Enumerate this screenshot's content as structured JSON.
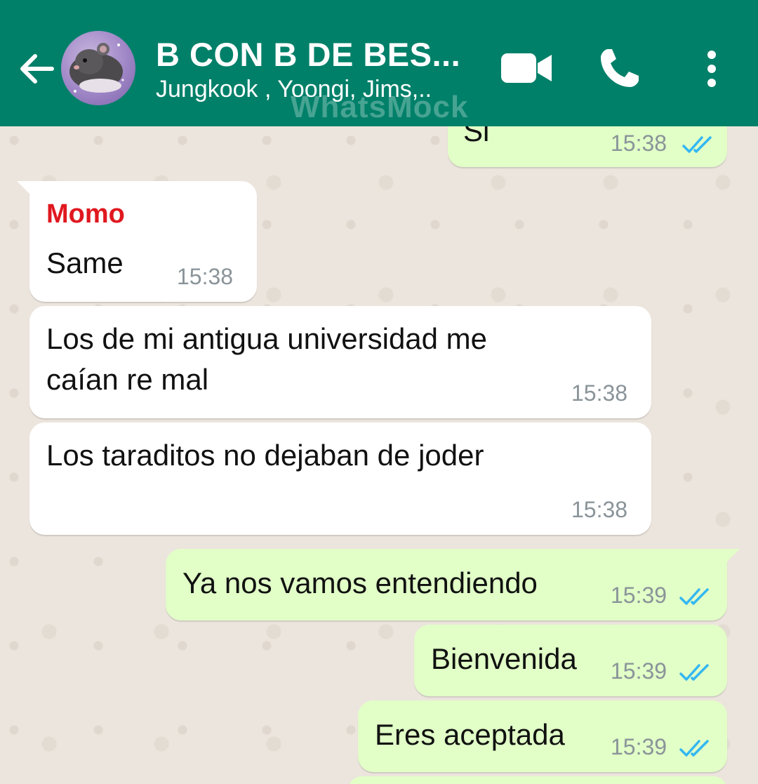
{
  "header": {
    "title": "B CON B DE BES...",
    "subtitle": "Jungkook , Yoongi, Jims,..",
    "watermark": "WhatsMock",
    "bg_color": "#008069",
    "icons": [
      "back-arrow-icon",
      "video-call-icon",
      "phone-call-icon",
      "more-options-icon"
    ]
  },
  "messages": [
    {
      "direction": "outgoing",
      "text": "Si",
      "time": "15:38",
      "ticks": "read"
    },
    {
      "direction": "incoming",
      "sender": "Momo",
      "text": "Same",
      "time": "15:38"
    },
    {
      "direction": "incoming",
      "text": "Los de mi antigua universidad me",
      "text2": "caían re mal",
      "time": "15:38"
    },
    {
      "direction": "incoming",
      "text": "Los taraditos no dejaban de joder",
      "time": "15:38"
    },
    {
      "direction": "outgoing",
      "text": "Ya nos vamos entendiendo",
      "time": "15:39",
      "ticks": "read"
    },
    {
      "direction": "outgoing",
      "text": "Bienvenida",
      "time": "15:39",
      "ticks": "read"
    },
    {
      "direction": "outgoing",
      "text": "Eres aceptada",
      "time": "15:39",
      "ticks": "read"
    }
  ],
  "colors": {
    "incoming_bubble": "#ffffff",
    "outgoing_bubble": "#e1ffc7",
    "sender_name": "#e0181f",
    "read_ticks": "#34b7f1",
    "chat_bg": "#ece5dd"
  }
}
